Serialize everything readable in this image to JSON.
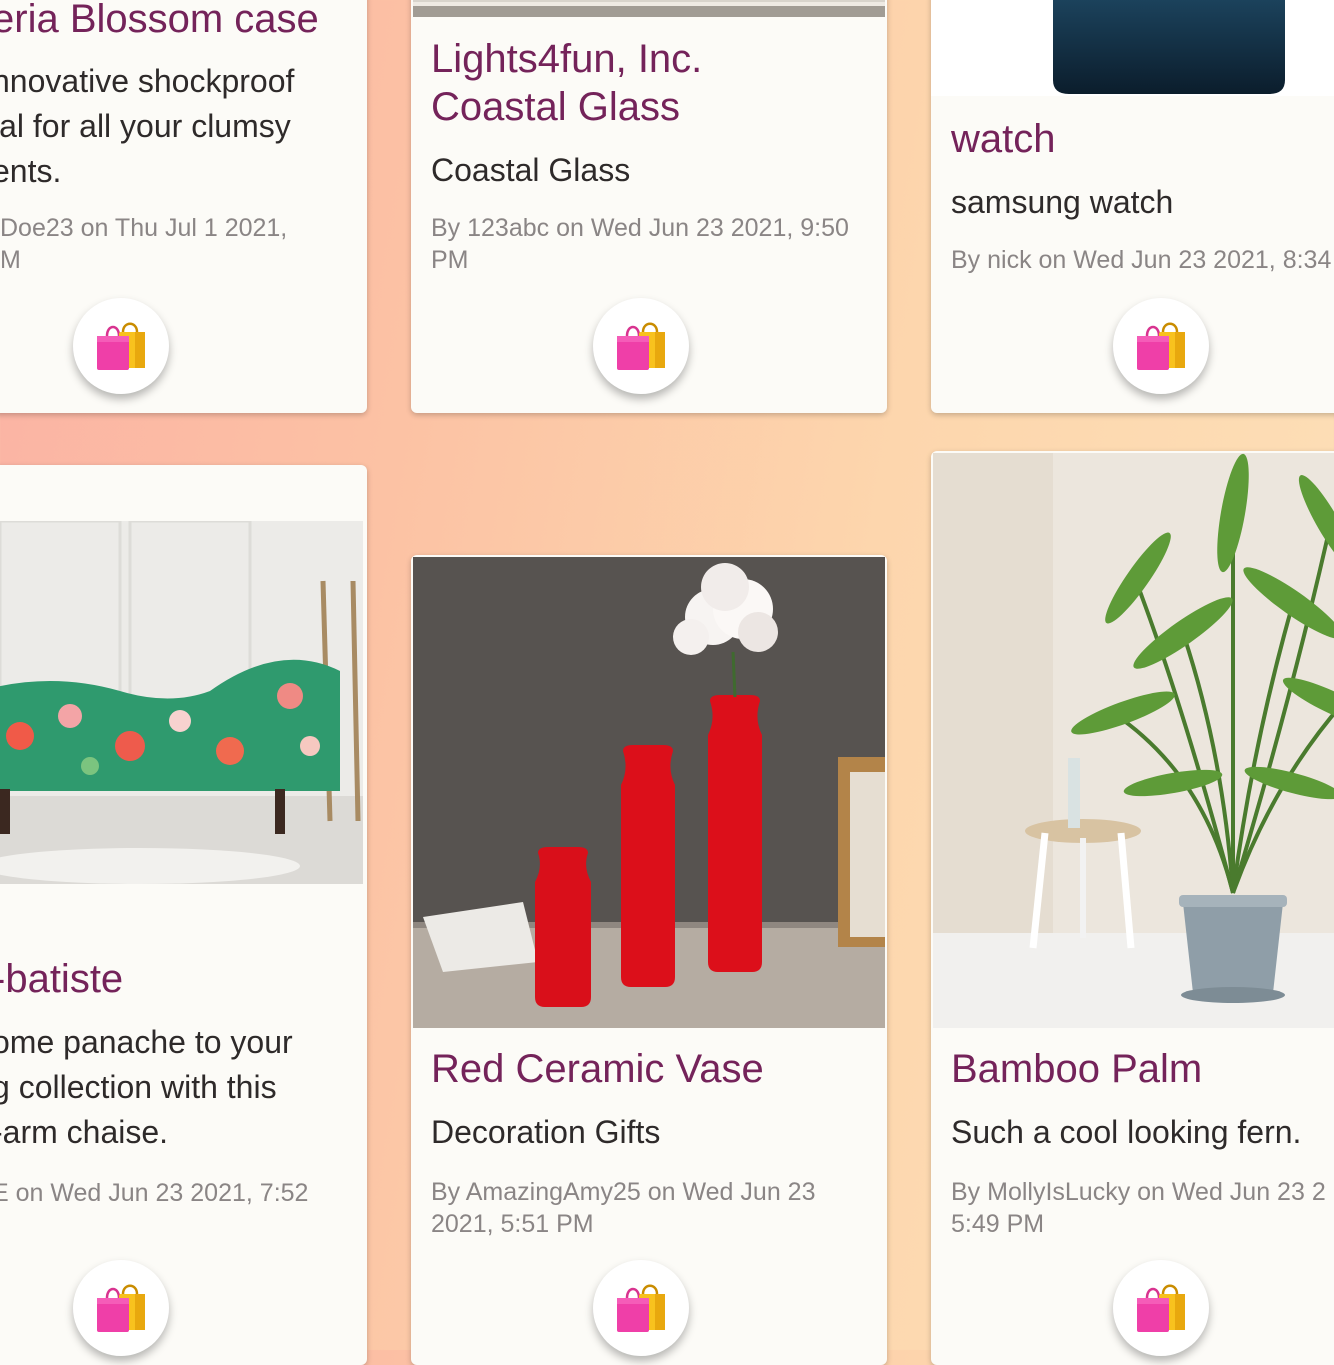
{
  "cards": [
    {
      "title": "eria Blossom case",
      "desc_lines": [
        "nnovative shockproof",
        "ial for all your clumsy",
        "ents."
      ],
      "meta_lines": [
        "Doe23 on Thu Jul 1 2021,",
        "M"
      ],
      "button_icon": "shopping-bags-icon"
    },
    {
      "title_lines": [
        "Lights4fun, Inc.",
        "Coastal Glass"
      ],
      "desc": "Coastal Glass",
      "meta_lines": [
        "By 123abc on Wed Jun 23 2021, 9:50",
        "PM"
      ],
      "button_icon": "shopping-bags-icon"
    },
    {
      "title": "watch",
      "desc": "samsung watch",
      "meta": "By nick on Wed Jun 23 2021, 8:34",
      "button_icon": "shopping-bags-icon"
    },
    {
      "title": "-batiste",
      "desc_lines": [
        "ome panache to your",
        "g collection with this",
        "-arm chaise."
      ],
      "meta": "E on Wed Jun 23 2021, 7:52",
      "button_icon": "shopping-bags-icon"
    },
    {
      "title": "Red Ceramic Vase",
      "desc": "Decoration Gifts",
      "meta_lines": [
        "By AmazingAmy25 on Wed Jun 23",
        "2021, 5:51 PM"
      ],
      "button_icon": "shopping-bags-icon"
    },
    {
      "title": "Bamboo Palm",
      "desc": "Such a cool looking fern.",
      "meta_lines": [
        "By MollyIsLucky on Wed Jun 23 2",
        "5:49 PM"
      ],
      "button_icon": "shopping-bags-icon"
    }
  ],
  "colors": {
    "title": "#74235a",
    "text": "#2e2a2a",
    "meta": "#8a8585",
    "card": "#fcfbf7"
  }
}
